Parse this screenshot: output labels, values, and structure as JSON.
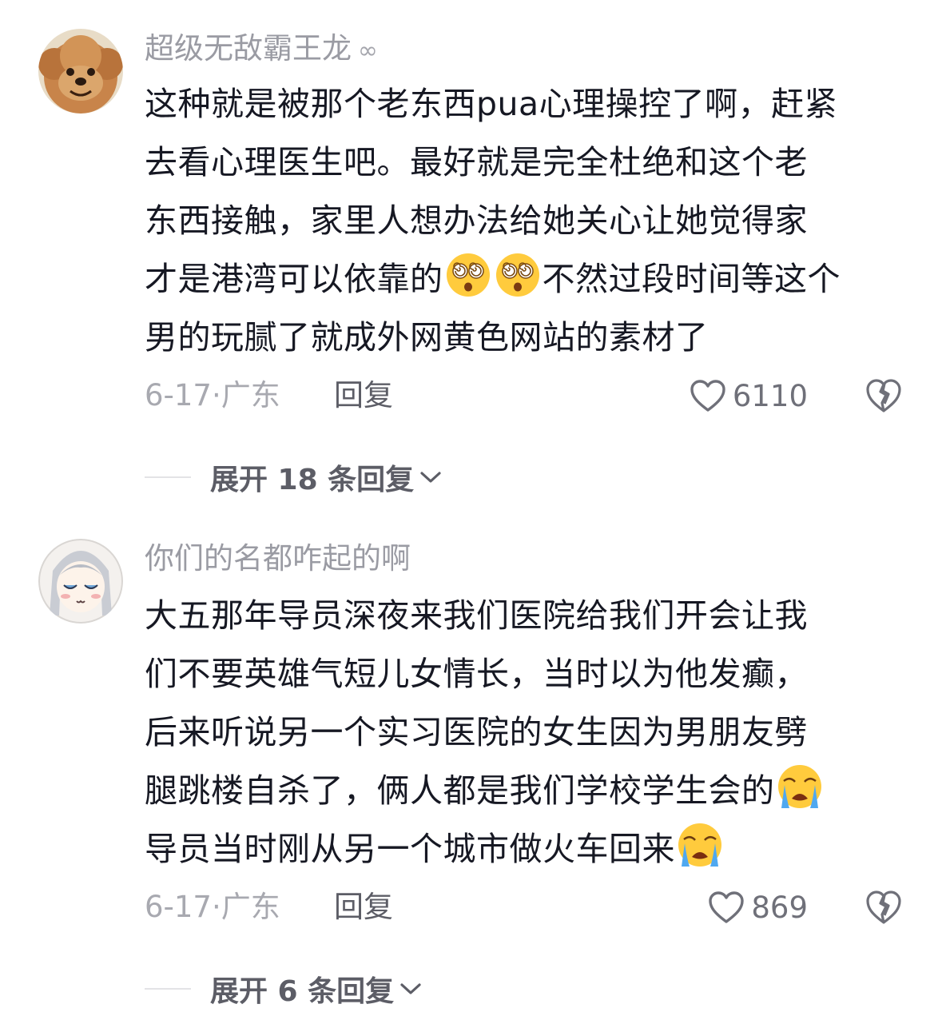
{
  "comments": [
    {
      "username": "超级无敌霸王龙",
      "link_mark": "∞",
      "avatar": "poodle-dog-avatar",
      "lines": [
        "这种就是被那个老东西pua心理操控了啊，赶紧",
        "去看心理医生吧。最好就是完全杜绝和这个老",
        "东西接触，家里人想办法给她关心让她觉得家",
        "才是港湾可以依靠的",
        "不然过段时间等这个",
        "男的玩腻了就成外网黄色网站的素材了"
      ],
      "emoji": "dizzy-face-emoji",
      "date": "6-17",
      "dot": "·",
      "location": "广东",
      "reply_label": "回复",
      "likes": "6110",
      "expand_label": "展开 18 条回复"
    },
    {
      "username": "你们的名都咋起的啊",
      "avatar": "anime-girl-avatar",
      "lines": [
        "大五那年导员深夜来我们医院给我们开会让我",
        "们不要英雄气短儿女情长，当时以为他发癫，",
        "后来听说另一个实习医院的女生因为男朋友劈",
        "腿跳楼自杀了，俩人都是我们学校学生会的",
        "导员当时刚从另一个城市做火车回来"
      ],
      "emoji": "crying-face-emoji",
      "date": "6-17",
      "dot": "·",
      "location": "广东",
      "reply_label": "回复",
      "likes": "869",
      "expand_label": "展开 6 条回复"
    }
  ],
  "icons": {
    "like": "heart-outline-icon",
    "dislike": "broken-heart-icon",
    "expand": "chevron-down-icon"
  },
  "colors": {
    "text": "#161823",
    "secondary": "#9a9ba3",
    "icon": "#6f7079"
  }
}
